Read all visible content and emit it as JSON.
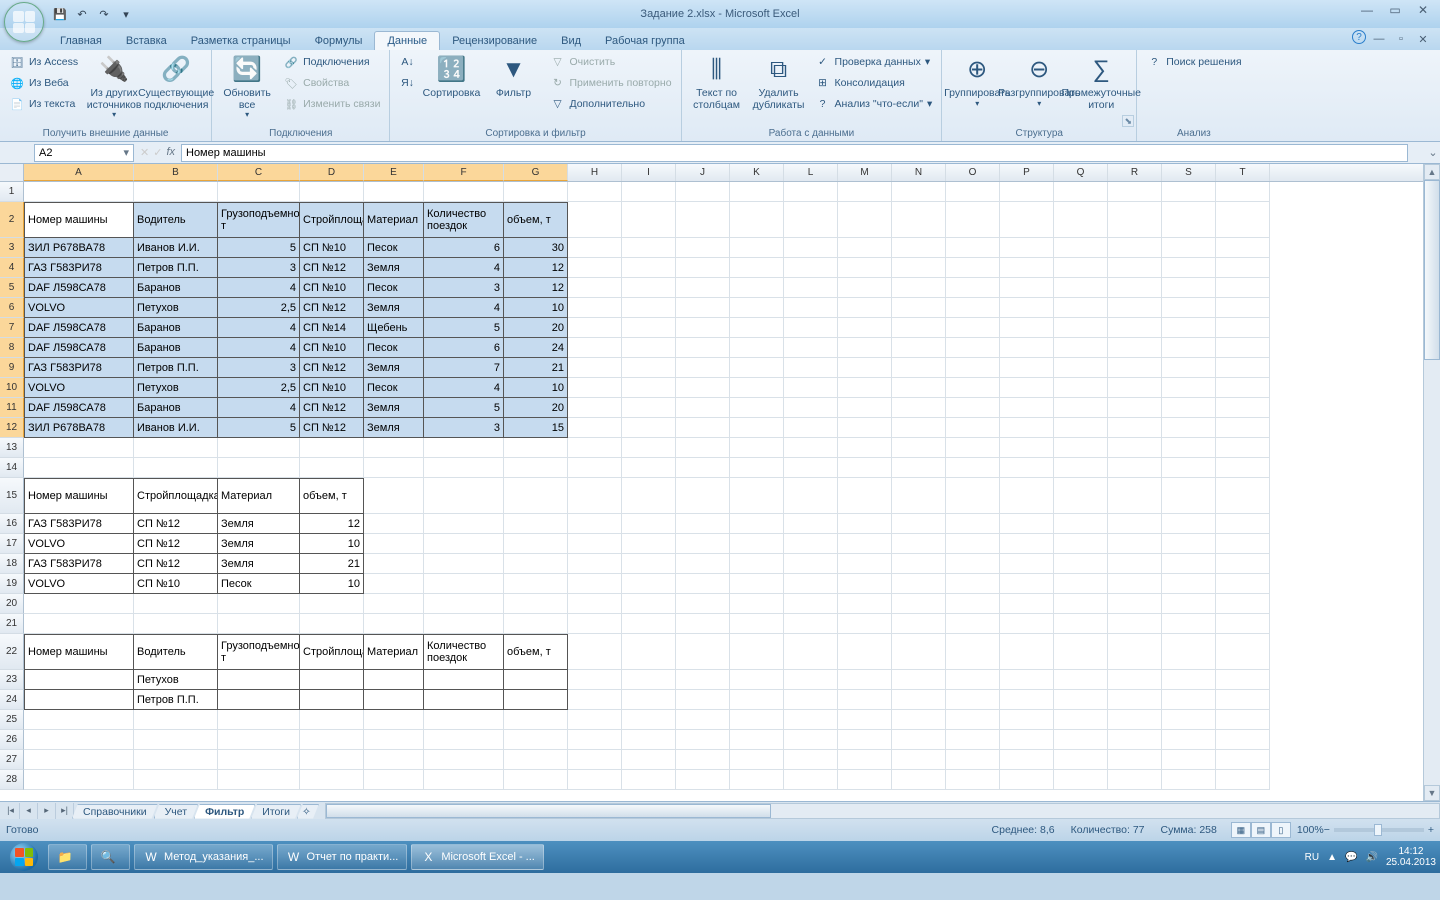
{
  "app": {
    "title": "Задание 2.xlsx - Microsoft Excel"
  },
  "qat": {
    "save": "💾",
    "undo": "↶",
    "redo": "↷"
  },
  "tabs": [
    "Главная",
    "Вставка",
    "Разметка страницы",
    "Формулы",
    "Данные",
    "Рецензирование",
    "Вид",
    "Рабочая группа"
  ],
  "activeTab": "Данные",
  "ribbon": {
    "g1": {
      "title": "Получить внешние данные",
      "access": "Из Access",
      "web": "Из Веба",
      "text": "Из текста",
      "other": "Из других источников",
      "existing": "Существующие подключения"
    },
    "g2": {
      "title": "Подключения",
      "refresh": "Обновить все",
      "conns": "Подключения",
      "props": "Свойства",
      "edit": "Изменить связи"
    },
    "g3": {
      "title": "Сортировка и фильтр",
      "sortaz": "А↓",
      "sortza": "Я↓",
      "sort": "Сортировка",
      "filter": "Фильтр",
      "clear": "Очистить",
      "reapply": "Применить повторно",
      "adv": "Дополнительно"
    },
    "g4": {
      "title": "Работа с данными",
      "t2c": "Текст по столбцам",
      "dup": "Удалить дубликаты",
      "valid": "Проверка данных",
      "consol": "Консолидация",
      "whatif": "Анализ \"что-если\""
    },
    "g5": {
      "title": "Структура",
      "group": "Группировать",
      "ungroup": "Разгруппировать",
      "subtotal": "Промежуточные итоги"
    },
    "g6": {
      "title": "Анализ",
      "solver": "Поиск решения"
    }
  },
  "namebox": "A2",
  "formula": "Номер машины",
  "columns": [
    "A",
    "B",
    "C",
    "D",
    "E",
    "F",
    "G",
    "H",
    "I",
    "J",
    "K",
    "L",
    "M",
    "N",
    "O",
    "P",
    "Q",
    "R",
    "S",
    "T"
  ],
  "table1": {
    "headers": [
      "Номер машины",
      "Водитель",
      "Грузоподъемность, т",
      "Стройплощадка",
      "Материал",
      "Количество поездок",
      "объем, т"
    ],
    "rows": [
      [
        "ЗИЛ Р678ВА78",
        "Иванов И.И.",
        "5",
        "СП №10",
        "Песок",
        "6",
        "30"
      ],
      [
        "ГАЗ Г583РИ78",
        "Петров  П.П.",
        "3",
        "СП №12",
        "Земля",
        "4",
        "12"
      ],
      [
        "DAF Л598СА78",
        "Баранов",
        "4",
        "СП №10",
        "Песок",
        "3",
        "12"
      ],
      [
        "VOLVO",
        "Петухов",
        "2,5",
        "СП №12",
        "Земля",
        "4",
        "10"
      ],
      [
        "DAF Л598СА78",
        "Баранов",
        "4",
        "СП №14",
        "Щебень",
        "5",
        "20"
      ],
      [
        "DAF Л598СА78",
        "Баранов",
        "4",
        "СП №10",
        "Песок",
        "6",
        "24"
      ],
      [
        "ГАЗ Г583РИ78",
        "Петров  П.П.",
        "3",
        "СП №12",
        "Земля",
        "7",
        "21"
      ],
      [
        "VOLVO",
        "Петухов",
        "2,5",
        "СП №10",
        "Песок",
        "4",
        "10"
      ],
      [
        "DAF Л598СА78",
        "Баранов",
        "4",
        "СП №12",
        "Земля",
        "5",
        "20"
      ],
      [
        "ЗИЛ Р678ВА78",
        "Иванов И.И.",
        "5",
        "СП №12",
        "Земля",
        "3",
        "15"
      ]
    ]
  },
  "table2": {
    "headers": [
      "Номер машины",
      "Стройплощадка",
      "Материал",
      "объем, т"
    ],
    "rows": [
      [
        "ГАЗ Г583РИ78",
        "СП №12",
        "Земля",
        "12"
      ],
      [
        "VOLVO",
        "СП №12",
        "Земля",
        "10"
      ],
      [
        "ГАЗ Г583РИ78",
        "СП №12",
        "Земля",
        "21"
      ],
      [
        "VOLVO",
        "СП №10",
        "Песок",
        "10"
      ]
    ]
  },
  "table3": {
    "headers": [
      "Номер машины",
      "Водитель",
      "Грузоподъемность, т",
      "Стройплощадка",
      "Материал",
      "Количество поездок",
      "объем, т"
    ],
    "rows": [
      [
        "",
        "Петухов",
        "",
        "",
        "",
        "",
        ""
      ],
      [
        "",
        "Петров  П.П.",
        "",
        "",
        "",
        "",
        ""
      ]
    ]
  },
  "sheets": [
    "Справочники",
    "Учет",
    "Фильтр",
    "Итоги"
  ],
  "activeSheet": "Фильтр",
  "status": {
    "ready": "Готово",
    "avg": "Среднее: 8,6",
    "count": "Количество: 77",
    "sum": "Сумма: 258",
    "zoom": "100%"
  },
  "taskbar": {
    "items": [
      {
        "icon": "📁",
        "label": ""
      },
      {
        "icon": "🔍",
        "label": ""
      },
      {
        "icon": "W",
        "label": "Метод_указания_..."
      },
      {
        "icon": "W",
        "label": "Отчет по практи..."
      },
      {
        "icon": "X",
        "label": "Microsoft Excel - ...",
        "active": true
      }
    ],
    "lang": "RU",
    "time": "14:12",
    "date": "25.04.2013"
  }
}
